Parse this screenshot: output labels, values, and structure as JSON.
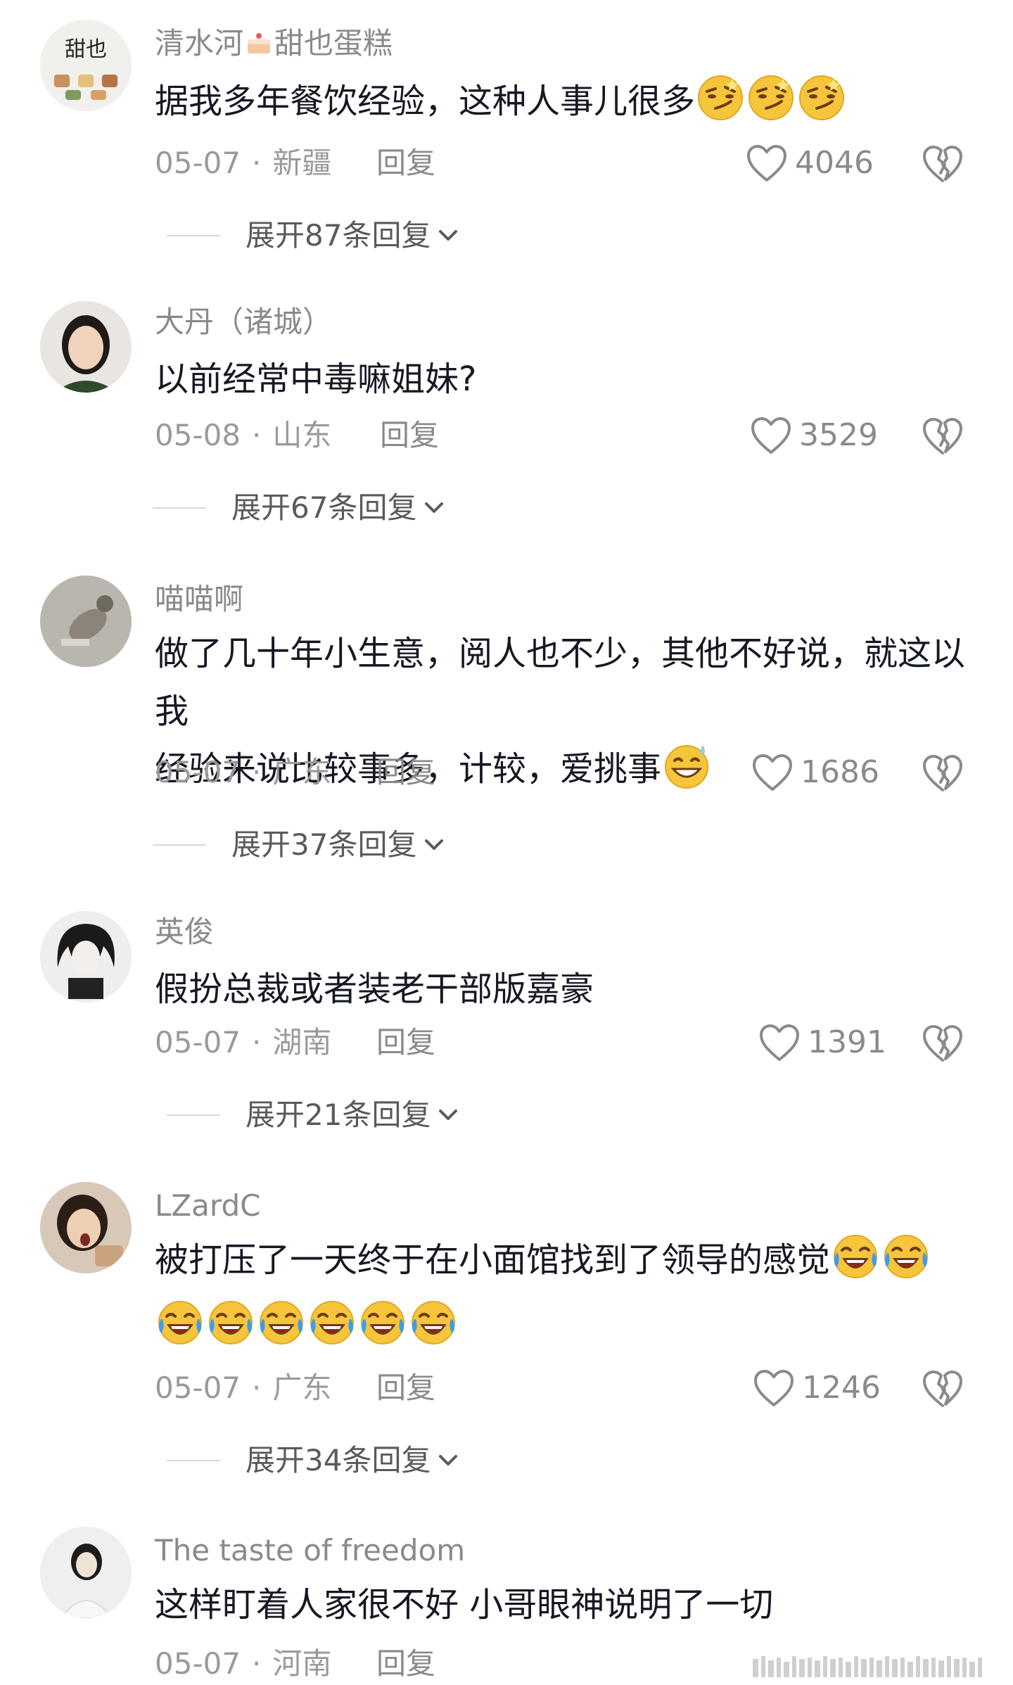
{
  "comments": [
    {
      "username": "清水河",
      "username_suffix": "甜也蛋糕",
      "text": "据我多年餐饮经验，这种人事儿很多",
      "emojis": [
        "smirk-emoji",
        "smirk-emoji",
        "smirk-emoji"
      ],
      "date": "05-07",
      "location": "新疆",
      "reply": "回复",
      "likes": "4046",
      "expand": "展开87条回复"
    },
    {
      "username": "大丹（诸城）",
      "text": "以前经常中毒嘛姐妹?",
      "date": "05-08",
      "location": "山东",
      "reply": "回复",
      "likes": "3529",
      "expand": "展开67条回复"
    },
    {
      "username": "喵喵啊",
      "text_line1": "做了几十年小生意，阅人也不少，其他不好说，就这以我",
      "text_line2": "经验来说比较事多，计较，爱挑事",
      "date": "05-07",
      "location": "广东",
      "reply": "回复",
      "likes": "1686",
      "expand": "展开37条回复"
    },
    {
      "username": "英俊",
      "text": "假扮总裁或者装老干部版嘉豪",
      "date": "05-07",
      "location": "湖南",
      "reply": "回复",
      "likes": "1391",
      "expand": "展开21条回复"
    },
    {
      "username": "LZardC",
      "text": "被打压了一天终于在小面馆找到了领导的感觉",
      "date": "05-07",
      "location": "广东",
      "reply": "回复",
      "likes": "1246",
      "expand": "展开34条回复"
    },
    {
      "username": "The taste of freedom",
      "text": "这样盯着人家很不好  小哥眼神说明了一切",
      "date": "05-07",
      "location": "河南",
      "reply": "回复"
    }
  ],
  "colors": {
    "text": "#161823",
    "muted": "#8a8a8a",
    "background": "#ffffff"
  },
  "icons": {
    "like": "heart-outline-icon",
    "dislike": "broken-heart-icon",
    "expand": "chevron-down-icon"
  }
}
